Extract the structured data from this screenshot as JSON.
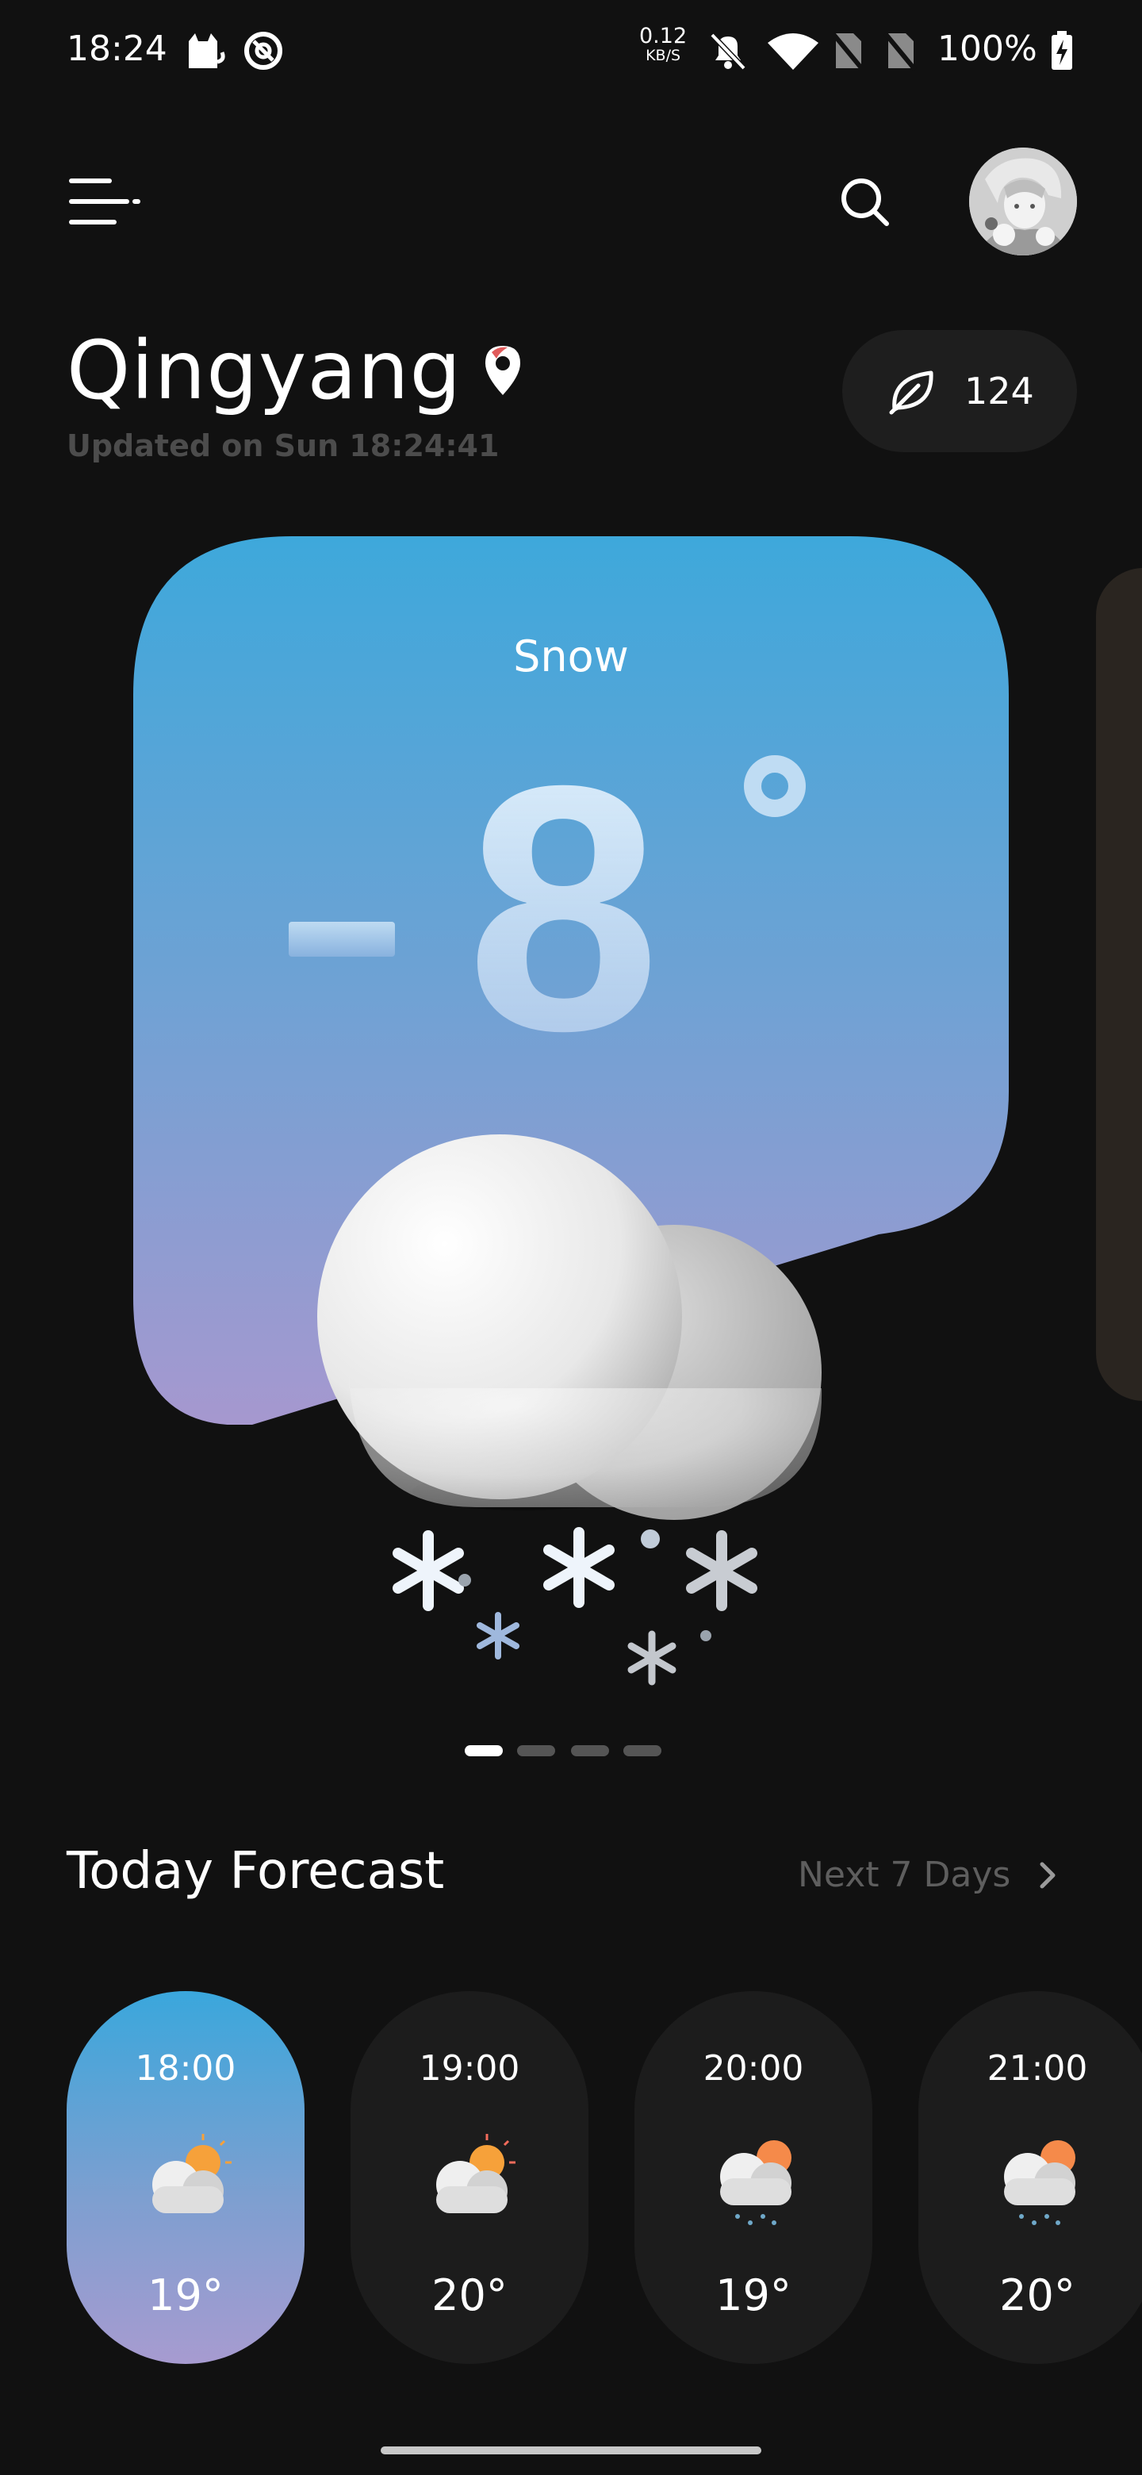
{
  "status_bar": {
    "time": "18:24",
    "net_speed": "0.12",
    "net_unit": "KB/S",
    "battery": "100%"
  },
  "location": {
    "city": "Qingyang",
    "updated": "Updated on Sun 18:24:41"
  },
  "aqi": {
    "value": "124"
  },
  "current": {
    "condition": "Snow",
    "temp_digits": "8"
  },
  "pager": {
    "count": 4,
    "active_index": 0
  },
  "forecast": {
    "title": "Today Forecast",
    "next_link": "Next 7 Days",
    "hours": [
      {
        "time": "18:00",
        "temp": "19°",
        "icon": "partly-cloudy-icon",
        "active": true
      },
      {
        "time": "19:00",
        "temp": "20°",
        "icon": "partly-cloudy-icon",
        "active": false
      },
      {
        "time": "20:00",
        "temp": "19°",
        "icon": "rain-icon",
        "active": false
      },
      {
        "time": "21:00",
        "temp": "20°",
        "icon": "rain-icon",
        "active": false
      }
    ]
  },
  "colors": {
    "background": "#111111",
    "card_top": "#3ea8db",
    "card_bottom": "#a698cf",
    "pill_bg": "#1c1c1c"
  }
}
